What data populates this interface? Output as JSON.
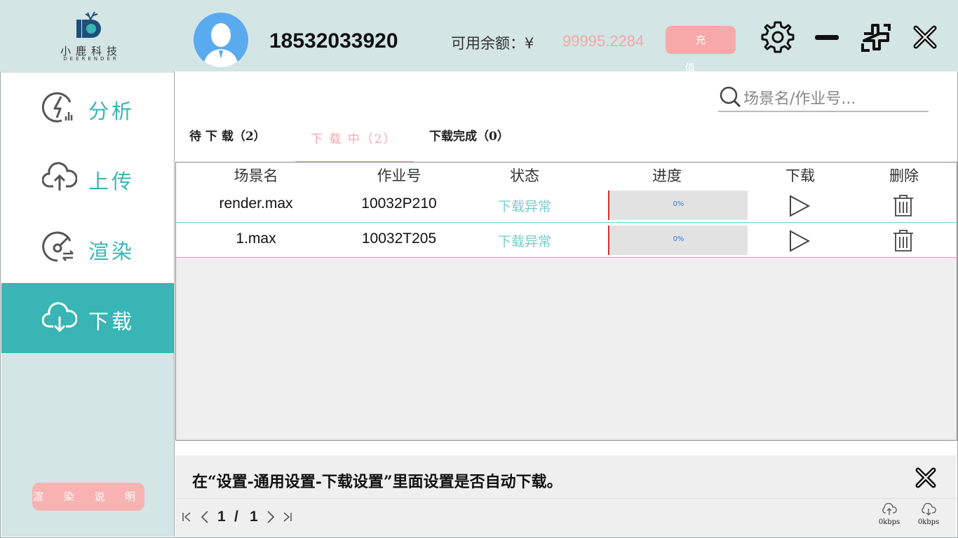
{
  "app": {
    "logo_cn": "小鹿科技",
    "logo_en": "DEERENDER"
  },
  "header": {
    "phone": "18532033920",
    "balance_label": "可用余额：¥",
    "balance_value": "99995.2284",
    "recharge_label": "充 值"
  },
  "sidebar": {
    "items": [
      {
        "label": "分析",
        "icon": "analysis-icon"
      },
      {
        "label": "上传",
        "icon": "cloud-upload-icon"
      },
      {
        "label": "渲染",
        "icon": "render-icon"
      },
      {
        "label": "下载",
        "icon": "cloud-download-icon",
        "active": true
      }
    ],
    "help_label": "渲 染 说 明"
  },
  "search": {
    "placeholder": "场景名/作业号..."
  },
  "tabs": [
    {
      "label": "待 下 载（2）"
    },
    {
      "label": "下 载 中（2）",
      "active": true
    },
    {
      "label": "下载完成（0）"
    }
  ],
  "table": {
    "headers": [
      "场景名",
      "作业号",
      "状态",
      "进度",
      "下载",
      "删除"
    ],
    "rows": [
      {
        "scene": "render.max",
        "job": "10032P210",
        "status": "下载异常",
        "progress": "0%"
      },
      {
        "scene": "1.max",
        "job": "10032T205",
        "status": "下载异常",
        "progress": "0%"
      }
    ]
  },
  "notice": {
    "text": "在“设置-通用设置-下载设置”里面设置是否自动下载。"
  },
  "pagination": {
    "current": "1",
    "separator": "/",
    "total": "1"
  },
  "speed": {
    "upload": "0kbps",
    "download": "0kbps"
  },
  "colors": {
    "accent": "#38b5b4",
    "pink": "#f7a8a8",
    "panel": "#d3e5e5"
  }
}
